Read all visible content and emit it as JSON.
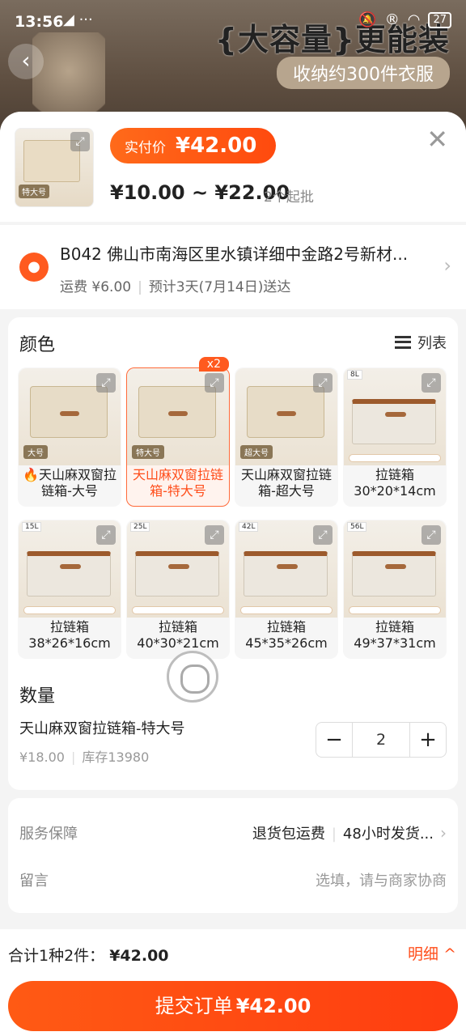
{
  "status": {
    "time": "13:56",
    "left_icons": "◢ ···",
    "battery": "27"
  },
  "background": {
    "headline": "{大容量}更能装",
    "subheadline": "收纳约300件衣服"
  },
  "sheet": {
    "header": {
      "thumb_tag": "特大号",
      "pay_label": "实付价",
      "pay_value": "¥42.00",
      "price_range": "¥10.00 ~ ¥22.00",
      "moq": "2个起批"
    },
    "address": {
      "line": "B042 佛山市南海区里水镇详细中金路2号新材...",
      "shipping": "运费 ¥6.00",
      "eta": "预计3天(7月14日)送达"
    },
    "color_section": {
      "title": "颜色",
      "list_toggle": "列表",
      "options": [
        {
          "name": "天山麻双窗拉链箱-大号",
          "fire": true,
          "size_tag": "大号",
          "style": "window"
        },
        {
          "name": "天山麻双窗拉链箱-特大号",
          "selected": true,
          "badge": "x2",
          "size_tag": "特大号",
          "style": "window"
        },
        {
          "name": "天山麻双窗拉链箱-超大号",
          "size_tag": "超大号",
          "style": "window"
        },
        {
          "name": "拉链箱\n30*20*14cm",
          "vol": "8L",
          "style": "zip"
        },
        {
          "name": "拉链箱\n38*26*16cm",
          "vol": "15L",
          "style": "zip"
        },
        {
          "name": "拉链箱\n40*30*21cm",
          "vol": "25L",
          "style": "zip"
        },
        {
          "name": "拉链箱\n45*35*26cm",
          "vol": "42L",
          "style": "zip"
        },
        {
          "name": "拉链箱\n49*37*31cm",
          "vol": "56L",
          "style": "zip"
        }
      ]
    },
    "quantity": {
      "title": "数量",
      "item": "天山麻双窗拉链箱-特大号",
      "price": "¥18.00",
      "stock": "库存13980",
      "value": "2",
      "minus": "−",
      "plus": "+"
    },
    "service": {
      "label": "服务保障",
      "item1": "退货包运费",
      "item2": "48小时发货...",
      "message_label": "留言",
      "message_placeholder": "选填，请与商家协商"
    },
    "footer": {
      "total_label": "合计1种2件：",
      "total_amount": "¥42.00",
      "detail": "明细 ^",
      "submit_label": "提交订单",
      "submit_price": "¥42.00"
    }
  }
}
